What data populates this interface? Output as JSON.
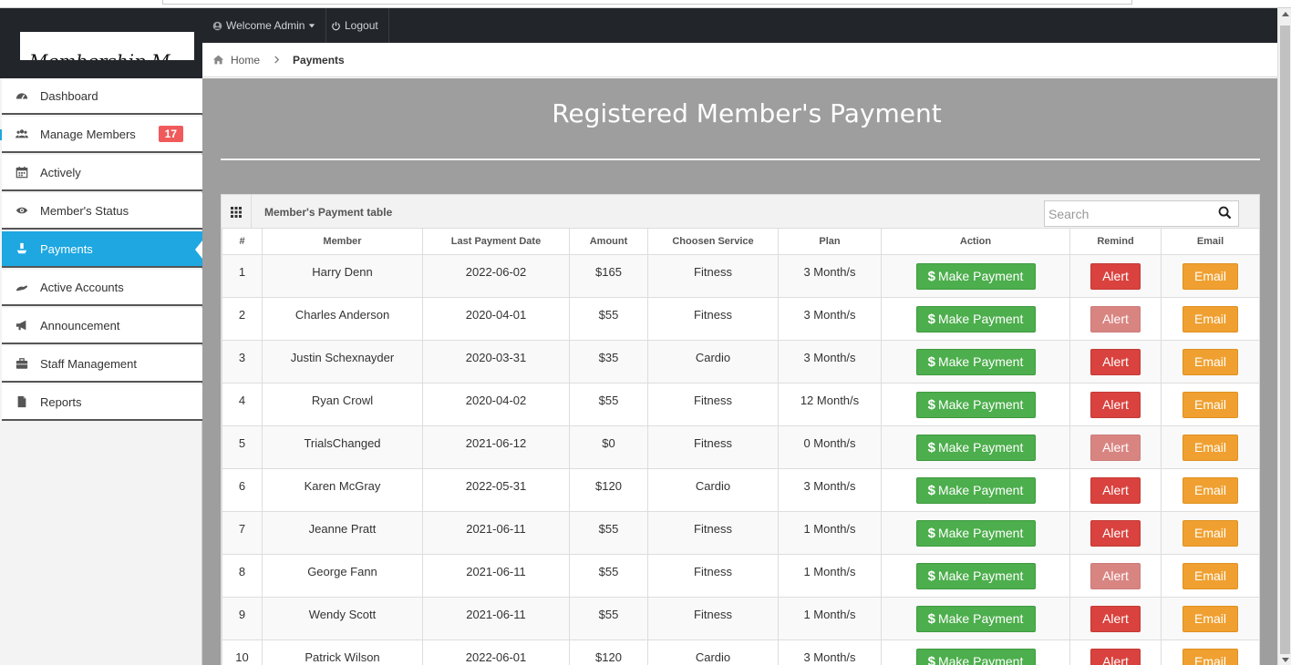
{
  "topnav": {
    "welcome_label": "Welcome Admin",
    "logout_label": "Logout"
  },
  "logo": {
    "text": "Membership M"
  },
  "breadcrumb": {
    "home": "Home",
    "current": "Payments"
  },
  "sidebar": {
    "items": [
      {
        "label": "Dashboard",
        "icon": "dashboard-icon"
      },
      {
        "label": "Manage Members",
        "icon": "users-icon",
        "badge": "17"
      },
      {
        "label": "Actively",
        "icon": "calendar-icon"
      },
      {
        "label": "Member's Status",
        "icon": "eye-icon"
      },
      {
        "label": "Payments",
        "icon": "payment-icon",
        "active": true
      },
      {
        "label": "Active Accounts",
        "icon": "accounts-icon"
      },
      {
        "label": "Announcement",
        "icon": "megaphone-icon"
      },
      {
        "label": "Staff Management",
        "icon": "briefcase-icon"
      },
      {
        "label": "Reports",
        "icon": "file-icon"
      }
    ]
  },
  "page": {
    "title": "Registered Member's Payment"
  },
  "panel": {
    "title": "Member's Payment table",
    "search_placeholder": "Search"
  },
  "table": {
    "headers": [
      "#",
      "Member",
      "Last Payment Date",
      "Amount",
      "Choosen Service",
      "Plan",
      "Action",
      "Remind",
      "Email"
    ],
    "action_label": "Make Payment",
    "alert_label": "Alert",
    "email_label": "Email",
    "rows": [
      {
        "num": "1",
        "member": "Harry Denn",
        "date": "2022-06-02",
        "amount": "$165",
        "service": "Fitness",
        "plan": "3 Month/s",
        "alert_dim": false
      },
      {
        "num": "2",
        "member": "Charles Anderson",
        "date": "2020-04-01",
        "amount": "$55",
        "service": "Fitness",
        "plan": "3 Month/s",
        "alert_dim": true
      },
      {
        "num": "3",
        "member": "Justin Schexnayder",
        "date": "2020-03-31",
        "amount": "$35",
        "service": "Cardio",
        "plan": "3 Month/s",
        "alert_dim": false
      },
      {
        "num": "4",
        "member": "Ryan Crowl",
        "date": "2020-04-02",
        "amount": "$55",
        "service": "Fitness",
        "plan": "12 Month/s",
        "alert_dim": false
      },
      {
        "num": "5",
        "member": "TrialsChanged",
        "date": "2021-06-12",
        "amount": "$0",
        "service": "Fitness",
        "plan": "0 Month/s",
        "alert_dim": true
      },
      {
        "num": "6",
        "member": "Karen McGray",
        "date": "2022-05-31",
        "amount": "$120",
        "service": "Cardio",
        "plan": "3 Month/s",
        "alert_dim": false
      },
      {
        "num": "7",
        "member": "Jeanne Pratt",
        "date": "2021-06-11",
        "amount": "$55",
        "service": "Fitness",
        "plan": "1 Month/s",
        "alert_dim": false
      },
      {
        "num": "8",
        "member": "George Fann",
        "date": "2021-06-11",
        "amount": "$55",
        "service": "Fitness",
        "plan": "1 Month/s",
        "alert_dim": true
      },
      {
        "num": "9",
        "member": "Wendy Scott",
        "date": "2021-06-11",
        "amount": "$55",
        "service": "Fitness",
        "plan": "1 Month/s",
        "alert_dim": false
      },
      {
        "num": "10",
        "member": "Patrick Wilson",
        "date": "2022-06-01",
        "amount": "$120",
        "service": "Cardio",
        "plan": "3 Month/s",
        "alert_dim": false
      }
    ]
  },
  "colors": {
    "topbar": "#22252a",
    "sidebar_active": "#1ea7e1",
    "content_bg": "#9e9e9e",
    "pay_button": "#4cae4c",
    "alert_button": "#d9423e",
    "email_button": "#f0a030",
    "badge": "#f05a5a"
  }
}
